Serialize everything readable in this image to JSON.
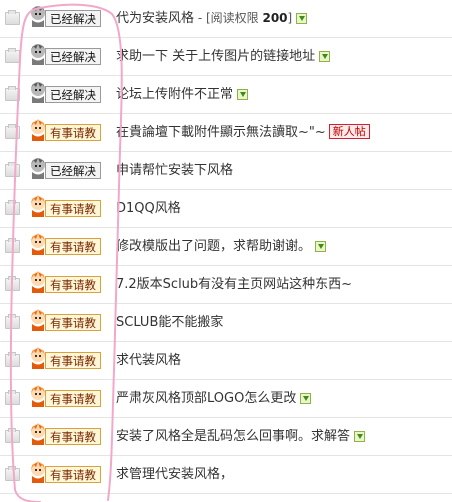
{
  "badges": {
    "solved": "已经解决",
    "help": "有事请教"
  },
  "new_label": "新人帖",
  "colors": {
    "highlight_circle": "#f2a8c8",
    "help_border": "#d9a23a",
    "solved_border": "#9a9a9a"
  },
  "threads": [
    {
      "badge": "solved",
      "title": "代为安装风格",
      "extra_prefix": " - [阅读权限 ",
      "extra_value": "200",
      "extra_suffix": "]",
      "attachment": true,
      "is_new": false
    },
    {
      "badge": "solved",
      "title": "求助一下 关于上传图片的链接地址",
      "attachment": true,
      "is_new": false
    },
    {
      "badge": "solved",
      "title": "论坛上传附件不正常",
      "attachment": true,
      "is_new": false
    },
    {
      "badge": "help",
      "title": "在貴論壇下載附件顯示無法讀取~\"~",
      "attachment": false,
      "is_new": true
    },
    {
      "badge": "solved",
      "title": "申请帮忙安装下风格",
      "attachment": false,
      "is_new": false
    },
    {
      "badge": "help",
      "title": "D1QQ风格",
      "attachment": false,
      "is_new": false
    },
    {
      "badge": "help",
      "title": "修改模版出了问题，求帮助谢谢。",
      "attachment": true,
      "is_new": false
    },
    {
      "badge": "help",
      "title": "7.2版本Sclub有没有主页网站这种东西~",
      "attachment": false,
      "is_new": false
    },
    {
      "badge": "help",
      "title": "SCLUB能不能搬家",
      "attachment": false,
      "is_new": false
    },
    {
      "badge": "help",
      "title": "求代装风格",
      "attachment": false,
      "is_new": false
    },
    {
      "badge": "help",
      "title": "严肃灰风格顶部LOGO怎么更改",
      "attachment": true,
      "is_new": false
    },
    {
      "badge": "help",
      "title": "安装了风格全是乱码怎么回事啊。求解答",
      "attachment": true,
      "is_new": false
    },
    {
      "badge": "help",
      "title": "求管理代安装风格，",
      "attachment": false,
      "is_new": false
    }
  ]
}
